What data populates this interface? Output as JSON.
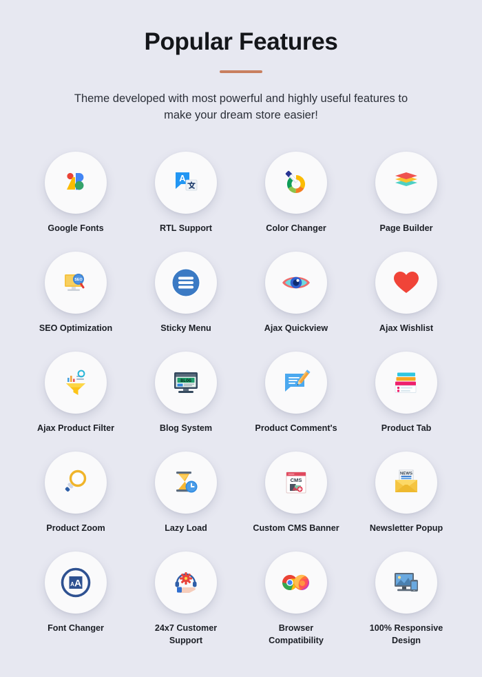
{
  "header": {
    "title": "Popular Features",
    "subtitle": "Theme developed with most powerful and highly useful features to make your dream store easier!",
    "accent_color": "#c87f5f",
    "background_color": "#e7e8f1",
    "tile_color": "#fafafb"
  },
  "features": [
    {
      "label": "Google Fonts",
      "icon": "google-fonts-icon"
    },
    {
      "label": "RTL Support",
      "icon": "translate-icon"
    },
    {
      "label": "Color Changer",
      "icon": "color-picker-icon"
    },
    {
      "label": "Page Builder",
      "icon": "layers-icon"
    },
    {
      "label": "SEO Optimization",
      "icon": "seo-monitor-icon"
    },
    {
      "label": "Sticky Menu",
      "icon": "hamburger-menu-icon"
    },
    {
      "label": "Ajax Quickview",
      "icon": "eye-icon"
    },
    {
      "label": "Ajax Wishlist",
      "icon": "heart-icon"
    },
    {
      "label": "Ajax Product Filter",
      "icon": "funnel-filter-icon"
    },
    {
      "label": "Blog System",
      "icon": "blog-monitor-icon"
    },
    {
      "label": "Product Comment's",
      "icon": "comment-pencil-icon"
    },
    {
      "label": "Product Tab",
      "icon": "tabs-icon"
    },
    {
      "label": "Product Zoom",
      "icon": "magnifier-icon"
    },
    {
      "label": "Lazy Load",
      "icon": "hourglass-clock-icon"
    },
    {
      "label": "Custom CMS Banner",
      "icon": "cms-banner-icon"
    },
    {
      "label": "Newsletter Popup",
      "icon": "newsletter-envelope-icon"
    },
    {
      "label": "Font Changer",
      "icon": "font-size-icon"
    },
    {
      "label": "24x7 Customer Support",
      "icon": "headset-support-icon"
    },
    {
      "label": "Browser Compatibility",
      "icon": "browsers-icon"
    },
    {
      "label": "100% Responsive Design",
      "icon": "responsive-devices-icon"
    }
  ]
}
